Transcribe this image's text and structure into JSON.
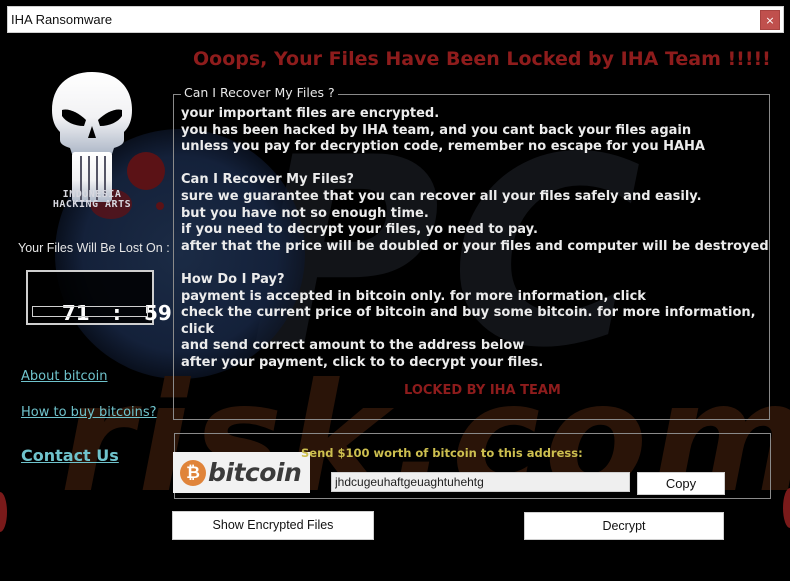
{
  "window": {
    "title": "IHA Ransomware",
    "close_icon": "close-icon",
    "close_glyph": "×"
  },
  "headline": "Ooops, Your Files Have Been Locked by IHA Team !!!!!",
  "logo": {
    "icon": "punisher-skull-icon",
    "line1": "INDONESIA",
    "line2": "HACKING ARTS"
  },
  "timer": {
    "label": "Your Files Will Be Lost On :",
    "hours": "71",
    "separator": ":",
    "minutes": "59",
    "progress_fraction": 0.0
  },
  "links": {
    "about": "About bitcoin",
    "how_to_buy": "How to buy bitcoins?",
    "contact": "Contact Us"
  },
  "message_group": {
    "legend": "Can I Recover My Files ?",
    "lines": [
      "your important files are encrypted.",
      "you has been hacked by IHA team, and you cant back your files again",
      "unless you pay for decryption code, remember no escape for you HAHA",
      "",
      "Can I Recover My Files?",
      "sure we guarantee that you can recover all your files safely and easily.",
      "but you have not so enough time.",
      "if you need to decrypt your files, yo need to pay.",
      "after that the price will be doubled or your files and computer will be destroyed",
      "",
      "How Do I Pay?",
      "payment is accepted in bitcoin only. for more information, click",
      "check the current price of bitcoin and buy some bitcoin. for more information,",
      "click",
      "and send correct amount to the address below",
      "after your payment, click to to decrypt your files."
    ],
    "footer": "LOCKED BY IHA TEAM"
  },
  "payment": {
    "bitcoin_logo_icon": "bitcoin-icon",
    "bitcoin_symbol": "₿",
    "bitcoin_word": "bitcoin",
    "send_label": "Send $100 worth of bitcoin to this address:",
    "address_value": "jhdcugeuhaftgeuaghtuhehtg",
    "copy_label": "Copy"
  },
  "buttons": {
    "show_encrypted": "Show Encrypted Files",
    "decrypt": "Decrypt"
  },
  "watermark": {
    "top": "PC",
    "bottom": "risk.com"
  },
  "colors": {
    "headline_red": "#8e1c1c",
    "link_teal": "#6fc3cc",
    "send_label_gold": "#cdbf4f",
    "close_red": "#c0504d",
    "bitcoin_orange": "#e0843a"
  }
}
